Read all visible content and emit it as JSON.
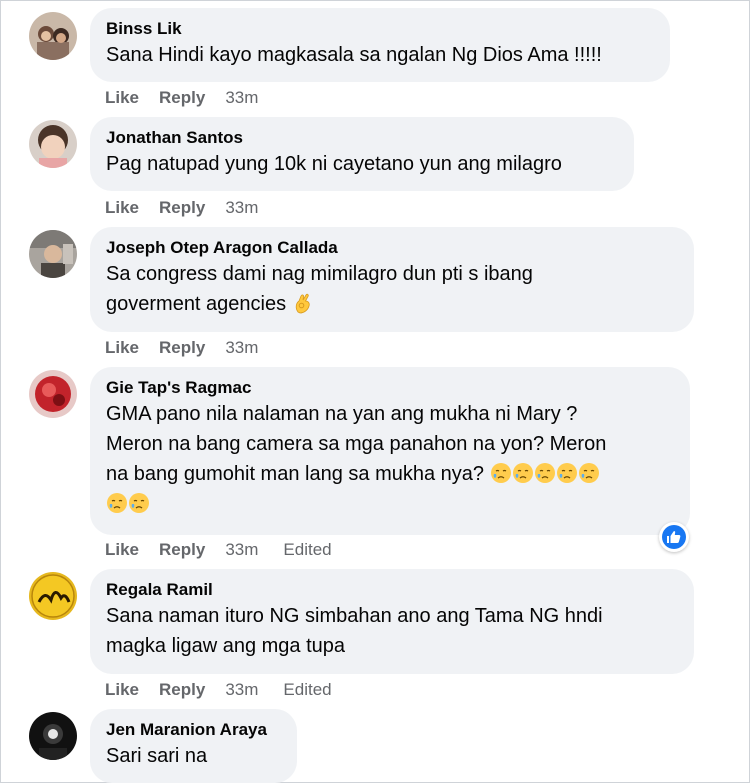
{
  "actions": {
    "like": "Like",
    "reply": "Reply"
  },
  "comments": [
    {
      "author": "Binss Lik",
      "lines": [
        "Sana Hindi kayo magkasala sa ngalan Ng Dios Ama !!!!!"
      ],
      "time": "33m",
      "edited": ""
    },
    {
      "author": "Jonathan Santos",
      "lines": [
        "Pag natupad yung 10k ni cayetano yun ang milagro"
      ],
      "time": "33m",
      "edited": ""
    },
    {
      "author": "Joseph Otep Aragon Callada",
      "lines": [
        "Sa congress dami nag mimilagro dun pti s ibang",
        "goverment agencies"
      ],
      "time": "33m",
      "edited": ""
    },
    {
      "author": "Gie Tap's Ragmac",
      "lines": [
        "GMA pano nila nalaman na yan ang mukha ni Mary ?",
        "Meron na bang camera sa mga panahon na yon? Meron",
        "na bang gumohit man lang sa mukha nya?"
      ],
      "time": "33m",
      "edited": "Edited"
    },
    {
      "author": "Regala Ramil",
      "lines": [
        "Sana naman ituro NG simbahan ano ang Tama NG hndi",
        "magka ligaw ang mga tupa"
      ],
      "time": "33m",
      "edited": "Edited"
    },
    {
      "author": "Jen Maranion Araya",
      "lines": [
        "Sari sari na"
      ],
      "time": "",
      "edited": ""
    }
  ],
  "icons": {
    "ok_hand": "ok-hand-emoji",
    "sad_face": "sad-relieved-face-emoji",
    "like_reaction": "thumbs-up-icon"
  },
  "colors": {
    "bubble": "#f0f2f5",
    "meta": "#65676b",
    "like_blue": "#1877f2"
  }
}
